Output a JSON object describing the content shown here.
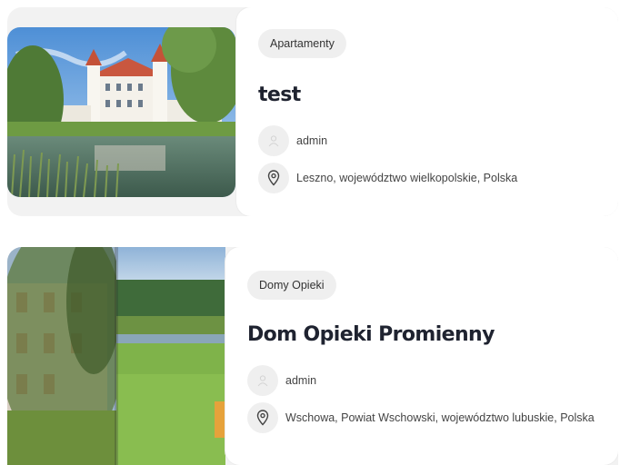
{
  "listings": [
    {
      "category": "Apartamenty",
      "title": "test",
      "author": "admin",
      "location": "Leszno, województwo wielkopolskie, Polska",
      "image_icon": "castle-photo"
    },
    {
      "category": "Domy Opieki",
      "title": "Dom Opieki Promienny",
      "author": "admin",
      "location": "Wschowa, Powiat Wschowski, województwo lubuskie, Polska",
      "image_icon": "care-home-photo"
    }
  ],
  "icons": {
    "author": "user-avatar-icon",
    "location": "map-pin-icon"
  }
}
